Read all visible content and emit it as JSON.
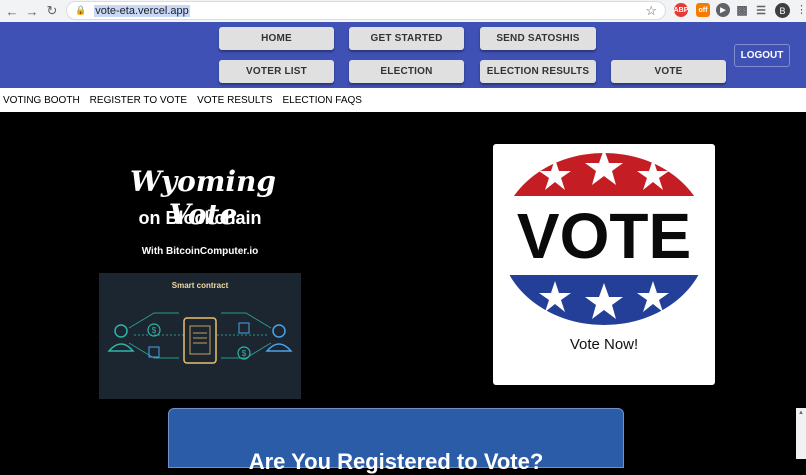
{
  "browser": {
    "url": "vote-eta.vercel.app",
    "back_icon": "arrow-left-icon",
    "forward_icon": "arrow-right-icon",
    "reload_icon": "reload-icon",
    "profile_initial": "B",
    "ext_abp_label": "ABP",
    "ext_off_label": "off"
  },
  "header": {
    "buttons_row1": [
      "HOME",
      "GET STARTED",
      "SEND SATOSHIS"
    ],
    "buttons_row2": [
      "VOTER LIST",
      "ELECTION",
      "ELECTION RESULTS",
      "VOTE"
    ],
    "logout": "LOGOUT",
    "bg_color": "#3f51b5"
  },
  "subnav": {
    "items": [
      "VOTING BOOTH",
      "REGISTER TO VOTE",
      "VOTE RESULTS",
      "ELECTION FAQS"
    ]
  },
  "hero": {
    "title": "Wyoming Vote",
    "subtitle": "on Blockchain",
    "with_line": "With BitcoinComputer.io",
    "contract_title": "Smart contract"
  },
  "vote_card": {
    "badge_text": "VOTE",
    "caption": "Vote Now!"
  },
  "register": {
    "title": "Are You Registered to Vote?"
  }
}
